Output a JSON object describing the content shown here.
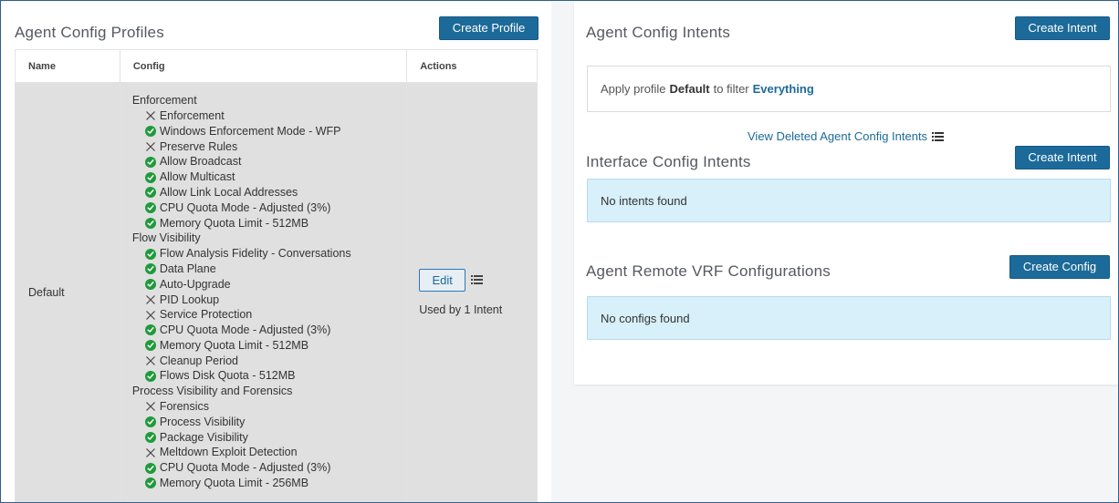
{
  "profiles": {
    "title": "Agent Config Profiles",
    "create_label": "Create Profile",
    "columns": {
      "name": "Name",
      "config": "Config",
      "actions": "Actions"
    },
    "row": {
      "name": "Default",
      "edit_label": "Edit",
      "used_by": "Used by 1 Intent",
      "groups": [
        {
          "label": "Enforcement",
          "items": [
            {
              "label": "Enforcement",
              "status": "disabled"
            },
            {
              "label": "Windows Enforcement Mode - WFP",
              "status": "enabled"
            },
            {
              "label": "Preserve Rules",
              "status": "disabled"
            },
            {
              "label": "Allow Broadcast",
              "status": "enabled"
            },
            {
              "label": "Allow Multicast",
              "status": "enabled"
            },
            {
              "label": "Allow Link Local Addresses",
              "status": "enabled"
            },
            {
              "label": "CPU Quota Mode - Adjusted (3%)",
              "status": "enabled"
            },
            {
              "label": "Memory Quota Limit - 512MB",
              "status": "enabled"
            }
          ]
        },
        {
          "label": "Flow Visibility",
          "items": [
            {
              "label": "Flow Analysis Fidelity - Conversations",
              "status": "enabled"
            },
            {
              "label": "Data Plane",
              "status": "enabled"
            },
            {
              "label": "Auto-Upgrade",
              "status": "enabled"
            },
            {
              "label": "PID Lookup",
              "status": "disabled"
            },
            {
              "label": "Service Protection",
              "status": "disabled"
            },
            {
              "label": "CPU Quota Mode - Adjusted (3%)",
              "status": "enabled"
            },
            {
              "label": "Memory Quota Limit - 512MB",
              "status": "enabled"
            },
            {
              "label": "Cleanup Period",
              "status": "disabled"
            },
            {
              "label": "Flows Disk Quota - 512MB",
              "status": "enabled"
            }
          ]
        },
        {
          "label": "Process Visibility and Forensics",
          "items": [
            {
              "label": "Forensics",
              "status": "disabled"
            },
            {
              "label": "Process Visibility",
              "status": "enabled"
            },
            {
              "label": "Package Visibility",
              "status": "enabled"
            },
            {
              "label": "Meltdown Exploit Detection",
              "status": "disabled"
            },
            {
              "label": "CPU Quota Mode - Adjusted (3%)",
              "status": "enabled"
            },
            {
              "label": "Memory Quota Limit - 256MB",
              "status": "enabled"
            }
          ]
        }
      ]
    }
  },
  "intents": {
    "title": "Agent Config Intents",
    "create_label": "Create Intent",
    "apply_prefix": "Apply profile",
    "profile_name": "Default",
    "apply_middle": "to filter",
    "filter_name": "Everything",
    "view_deleted_label": "View Deleted Agent Config Intents"
  },
  "interface_intents": {
    "title": "Interface Config Intents",
    "create_label": "Create Intent",
    "empty_message": "No intents found"
  },
  "remote_vrf": {
    "title": "Agent Remote VRF Configurations",
    "create_label": "Create Config",
    "empty_message": "No configs found"
  },
  "colors": {
    "primary": "#1c6a99",
    "enabled": "#1f9a3b",
    "info_bg": "#d7f0fa"
  }
}
